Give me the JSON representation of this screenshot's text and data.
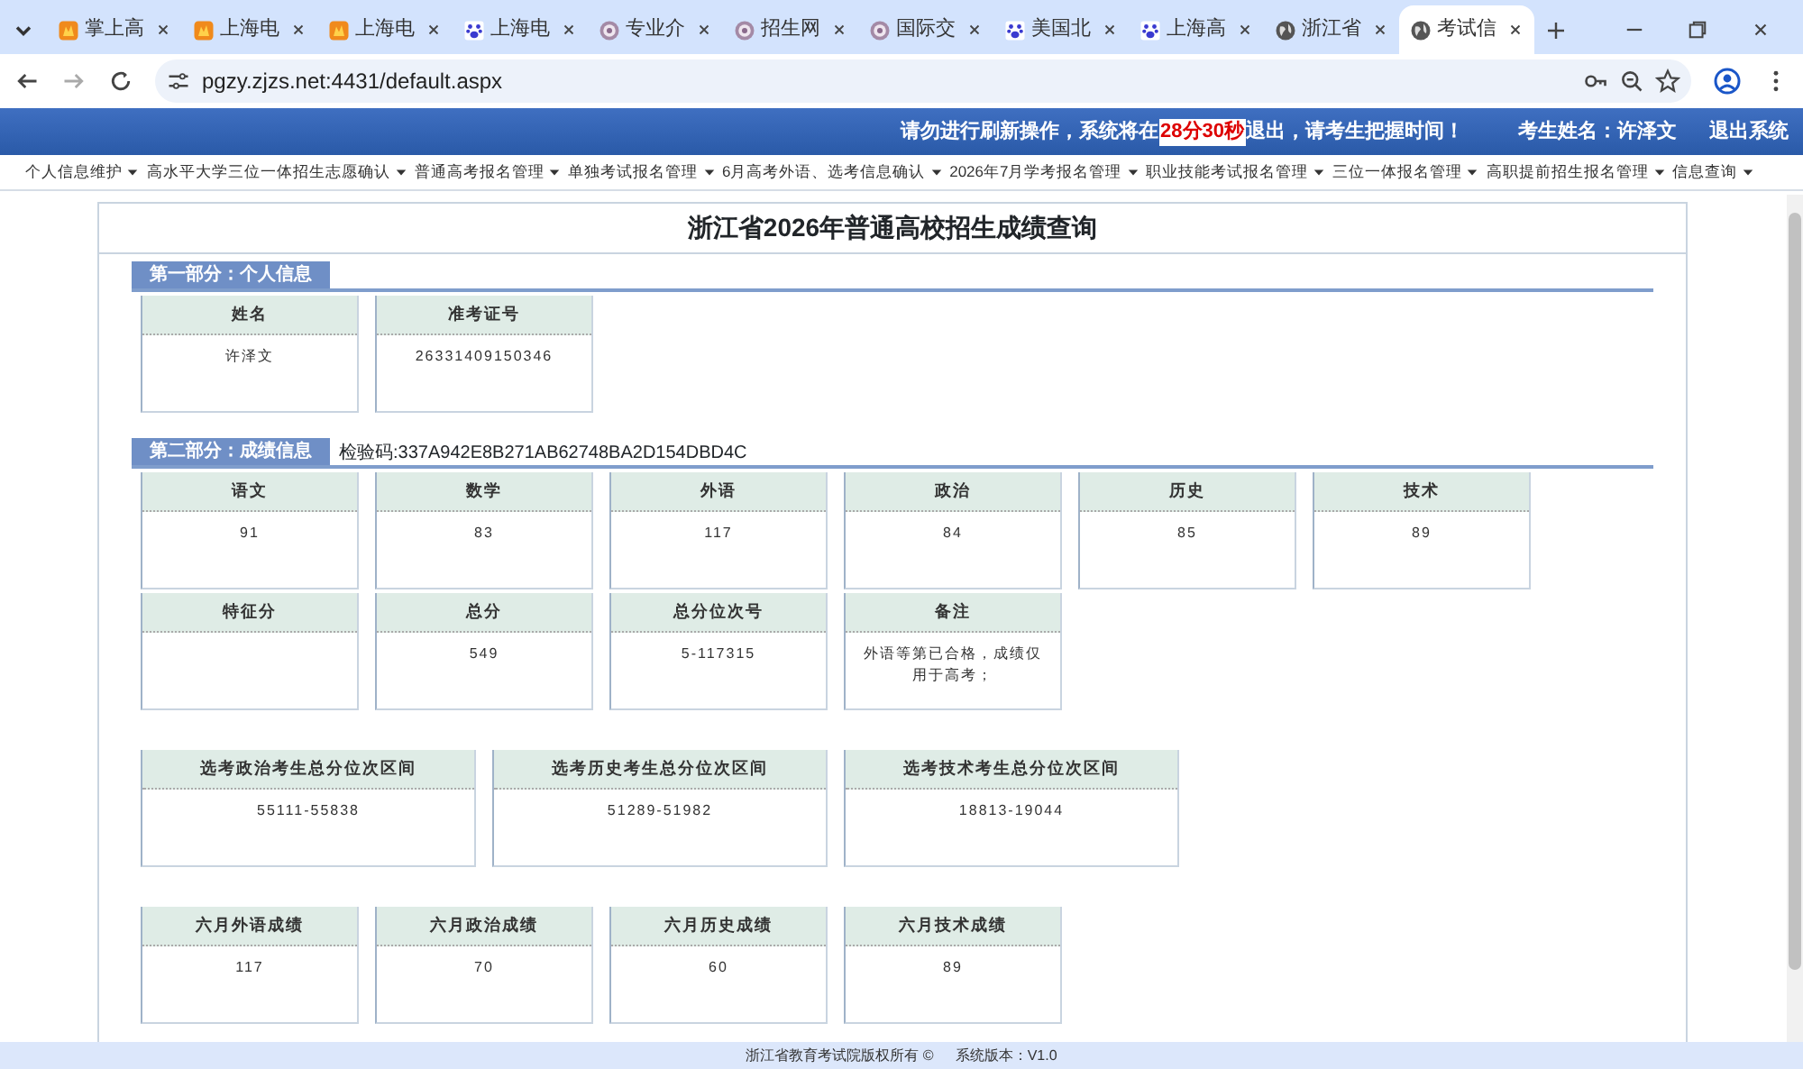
{
  "browser": {
    "tabs": [
      {
        "title": "掌上高",
        "kind": "flame",
        "selected": false
      },
      {
        "title": "上海电",
        "kind": "flame",
        "selected": false
      },
      {
        "title": "上海电",
        "kind": "flame",
        "selected": false
      },
      {
        "title": "上海电",
        "kind": "paw",
        "selected": false
      },
      {
        "title": "专业介",
        "kind": "disc",
        "selected": false
      },
      {
        "title": "招生网",
        "kind": "disc",
        "selected": false
      },
      {
        "title": "国际交",
        "kind": "disc",
        "selected": false
      },
      {
        "title": "美国北",
        "kind": "paw",
        "selected": false
      },
      {
        "title": "上海高",
        "kind": "paw",
        "selected": false
      },
      {
        "title": "浙江省",
        "kind": "globe",
        "selected": false
      },
      {
        "title": "考试信",
        "kind": "globe",
        "selected": true
      }
    ],
    "url": "pgzy.zjzs.net:4431/default.aspx"
  },
  "header": {
    "notice_before": "请勿进行刷新操作，系统将在",
    "countdown": "28分30秒",
    "notice_after": "退出，请考生把握时间！",
    "student": "考生姓名：许泽文",
    "logout": "退出系统"
  },
  "menu": [
    "个人信息维护",
    "高水平大学三位一体招生志愿确认",
    "普通高考报名管理",
    "单独考试报名管理",
    "6月高考外语、选考信息确认",
    "2026年7月学考报名管理",
    "职业技能考试报名管理",
    "三位一体报名管理",
    "高职提前招生报名管理",
    "信息查询"
  ],
  "page": {
    "title": "浙江省2026年普通高校招生成绩查询",
    "sections": [
      {
        "heading": "第一部分：个人信息",
        "rows": [
          {
            "kind": "normal",
            "cards": [
              {
                "label": "姓名",
                "value": "许泽文"
              },
              {
                "label": "准考证号",
                "value": "26331409150346"
              }
            ]
          }
        ]
      },
      {
        "heading": "第二部分：成绩信息",
        "note": "检验码:337A942E8B271AB62748BA2D154DBD4C",
        "rows": [
          {
            "kind": "normal",
            "cards": [
              {
                "label": "语文",
                "value": "91"
              },
              {
                "label": "数学",
                "value": "83"
              },
              {
                "label": "外语",
                "value": "117"
              },
              {
                "label": "政治",
                "value": "84"
              },
              {
                "label": "历史",
                "value": "85"
              },
              {
                "label": "技术",
                "value": "89"
              }
            ]
          },
          {
            "kind": "normal",
            "cards": [
              {
                "label": "特征分"
              },
              {
                "label": "总分",
                "value": "549"
              },
              {
                "label": "总分位次号",
                "value": "5-117315"
              },
              {
                "label": "备注",
                "value": "外语等第已合格，成绩仅用于高考；"
              }
            ]
          },
          {
            "kind": "wide",
            "cards": [
              {
                "label": "选考政治考生总分位次区间",
                "value": "55111-55838"
              },
              {
                "label": "选考历史考生总分位次区间",
                "value": "51289-51982"
              },
              {
                "label": "选考技术考生总分位次区间",
                "value": "18813-19044"
              }
            ]
          },
          {
            "kind": "normal",
            "cards": [
              {
                "label": "六月外语成绩",
                "value": "117"
              },
              {
                "label": "六月政治成绩",
                "value": "70"
              },
              {
                "label": "六月历史成绩",
                "value": "60"
              },
              {
                "label": "六月技术成绩",
                "value": "89"
              }
            ]
          }
        ]
      }
    ]
  },
  "footer": {
    "copyright": "浙江省教育考试院版权所有 ©",
    "version": "系统版本：V1.0"
  }
}
